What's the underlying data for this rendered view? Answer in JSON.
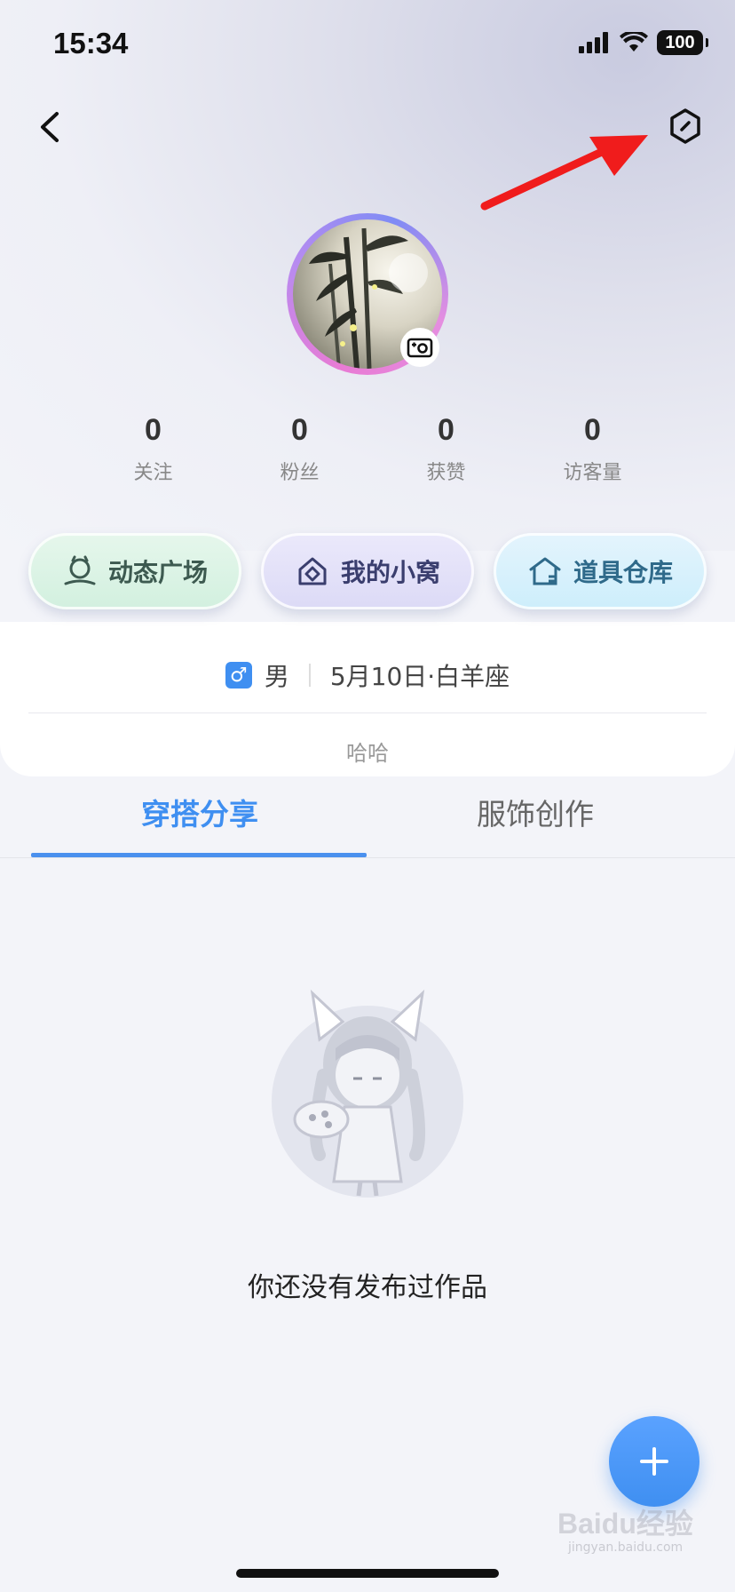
{
  "status_bar": {
    "time": "15:34",
    "battery": "100",
    "icons": [
      "signal-icon",
      "wifi-icon",
      "battery-icon"
    ]
  },
  "header": {
    "back_icon": "chevron-left-icon",
    "settings_icon": "hexagon-settings-icon"
  },
  "profile": {
    "avatar_badge_icon": "camera-icon",
    "stats": [
      {
        "value": "0",
        "label": "关注"
      },
      {
        "value": "0",
        "label": "粉丝"
      },
      {
        "value": "0",
        "label": "获赞"
      },
      {
        "value": "0",
        "label": "访客量"
      }
    ],
    "gender_symbol": "♂",
    "gender": "男",
    "birthday": "5月10日·白羊座",
    "bio": "哈哈"
  },
  "quick_buttons": [
    {
      "label": "动态广场",
      "icon": "plaza-icon"
    },
    {
      "label": "我的小窝",
      "icon": "home-nest-icon"
    },
    {
      "label": "道具仓库",
      "icon": "warehouse-icon"
    }
  ],
  "tabs": [
    {
      "label": "穿搭分享",
      "active": true
    },
    {
      "label": "服饰创作",
      "active": false
    }
  ],
  "empty_state": {
    "text": "你还没有发布过作品"
  },
  "fab_icon": "plus-icon",
  "watermark": {
    "text": "Baidu经验",
    "url": "jingyan.baidu.com"
  },
  "colors": {
    "accent": "#3f8ff1",
    "annotation_arrow": "#f01c1c"
  }
}
